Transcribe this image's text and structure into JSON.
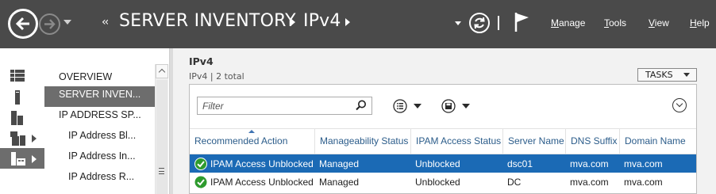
{
  "header": {
    "breadcrumb_chevrons": "‹‹",
    "breadcrumb": [
      "SERVER INVENTORY",
      "IPv4"
    ],
    "menu": [
      "Manage",
      "Tools",
      "View",
      "Help"
    ]
  },
  "rail": {
    "icons": [
      "dashboard-icon",
      "local-server-icon",
      "all-servers-icon",
      "file-services-icon",
      "ipam-icon"
    ]
  },
  "nav": {
    "items": [
      {
        "label": "OVERVIEW"
      },
      {
        "label": "SERVER INVEN..."
      },
      {
        "label": "IP ADDRESS SP..."
      },
      {
        "label": "IP Address Bl..."
      },
      {
        "label": "IP Address In..."
      },
      {
        "label": "IP Address R..."
      }
    ]
  },
  "content": {
    "title": "IPv4",
    "subtitle": "IPv4 | 2 total",
    "tasks_label": "TASKS",
    "filter_placeholder": "Filter",
    "columns": [
      "Recommended Action",
      "Manageability Status",
      "IPAM Access Status",
      "Server Name",
      "DNS Suffix",
      "Domain Name"
    ],
    "rows": [
      {
        "action": "IPAM Access Unblocked",
        "manageability": "Managed",
        "ipam_access": "Unblocked",
        "server": "dsc01",
        "dns": "mva.com",
        "domain": "mva.com",
        "selected": true
      },
      {
        "action": "IPAM Access Unblocked",
        "manageability": "Managed",
        "ipam_access": "Unblocked",
        "server": "DC",
        "dns": "mva.com",
        "domain": "mva.com",
        "selected": false
      }
    ]
  },
  "colors": {
    "titlebar": "#4a4a4a",
    "selection": "#1b6ab5",
    "header_link": "#2b5c8a",
    "ok_green": "#2e9b2e"
  }
}
